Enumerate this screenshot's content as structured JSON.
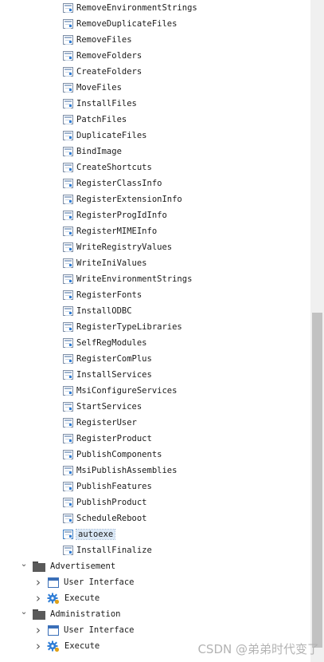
{
  "tree": {
    "leaf_items": [
      {
        "label": "RemoveEnvironmentStrings",
        "icon": "table-icon"
      },
      {
        "label": "RemoveDuplicateFiles",
        "icon": "table-icon"
      },
      {
        "label": "RemoveFiles",
        "icon": "table-icon"
      },
      {
        "label": "RemoveFolders",
        "icon": "table-icon"
      },
      {
        "label": "CreateFolders",
        "icon": "table-icon"
      },
      {
        "label": "MoveFiles",
        "icon": "table-icon"
      },
      {
        "label": "InstallFiles",
        "icon": "table-icon"
      },
      {
        "label": "PatchFiles",
        "icon": "table-icon"
      },
      {
        "label": "DuplicateFiles",
        "icon": "table-icon"
      },
      {
        "label": "BindImage",
        "icon": "table-icon"
      },
      {
        "label": "CreateShortcuts",
        "icon": "table-icon"
      },
      {
        "label": "RegisterClassInfo",
        "icon": "table-icon"
      },
      {
        "label": "RegisterExtensionInfo",
        "icon": "table-icon"
      },
      {
        "label": "RegisterProgIdInfo",
        "icon": "table-icon"
      },
      {
        "label": "RegisterMIMEInfo",
        "icon": "table-icon"
      },
      {
        "label": "WriteRegistryValues",
        "icon": "table-icon"
      },
      {
        "label": "WriteIniValues",
        "icon": "table-icon"
      },
      {
        "label": "WriteEnvironmentStrings",
        "icon": "table-icon"
      },
      {
        "label": "RegisterFonts",
        "icon": "table-icon"
      },
      {
        "label": "InstallODBC",
        "icon": "table-icon"
      },
      {
        "label": "RegisterTypeLibraries",
        "icon": "table-icon"
      },
      {
        "label": "SelfRegModules",
        "icon": "table-icon"
      },
      {
        "label": "RegisterComPlus",
        "icon": "table-icon"
      },
      {
        "label": "InstallServices",
        "icon": "table-icon"
      },
      {
        "label": "MsiConfigureServices",
        "icon": "table-icon"
      },
      {
        "label": "StartServices",
        "icon": "table-icon"
      },
      {
        "label": "RegisterUser",
        "icon": "table-icon"
      },
      {
        "label": "RegisterProduct",
        "icon": "table-icon"
      },
      {
        "label": "PublishComponents",
        "icon": "table-icon"
      },
      {
        "label": "MsiPublishAssemblies",
        "icon": "table-icon"
      },
      {
        "label": "PublishFeatures",
        "icon": "table-icon"
      },
      {
        "label": "PublishProduct",
        "icon": "table-icon"
      },
      {
        "label": "ScheduleReboot",
        "icon": "table-icon"
      },
      {
        "label": "autoexe",
        "icon": "table-icon",
        "selected": true
      },
      {
        "label": "InstallFinalize",
        "icon": "table-icon"
      }
    ],
    "groups": [
      {
        "label": "Advertisement",
        "icon": "folder-icon",
        "expanded": true,
        "children": [
          {
            "label": "User Interface",
            "icon": "ui-window-icon"
          },
          {
            "label": "Execute",
            "icon": "gear-icon"
          }
        ]
      },
      {
        "label": "Administration",
        "icon": "folder-icon",
        "expanded": true,
        "children": [
          {
            "label": "User Interface",
            "icon": "ui-window-icon"
          },
          {
            "label": "Execute",
            "icon": "gear-icon"
          }
        ]
      }
    ]
  },
  "watermark": "CSDN @弟弟时代变了",
  "colors": {
    "selection": "#dbe9f7",
    "icon_blue": "#3a6fb8",
    "gear_blue": "#2f7dd6",
    "scroll_thumb": "#c2c2c2"
  }
}
